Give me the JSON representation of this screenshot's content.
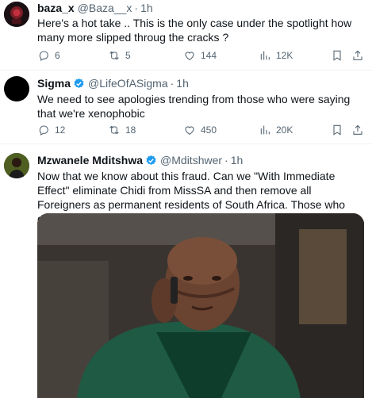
{
  "tweets": [
    {
      "name": "baza_x",
      "handle": "@Baza__x",
      "sep": "·",
      "time": "1h",
      "text": "Here's a hot take .. This is the only case under the spotlight how many more slipped throug the cracks ?",
      "replies": "6",
      "retweets": "5",
      "likes": "144",
      "views": "12K"
    },
    {
      "name": "Sigma",
      "handle": "@LifeOfASigma",
      "sep": "·",
      "time": "1h",
      "text": "We need to see apologies trending from those who were saying that we're xenophobic",
      "replies": "12",
      "retweets": "18",
      "likes": "450",
      "views": "20K"
    },
    {
      "name": "Mzwanele Mditshwa",
      "handle": "@Mditshwer",
      "sep": "·",
      "time": "1h",
      "text": "Now that we know about this fraud. Can we \"With Immediate Effect\" eliminate Chidi from MissSA and then remove all Foreigners as permanent residents of South Africa. Those who deserve it must apply again"
    }
  ],
  "icons": {
    "reply": "reply-icon",
    "retweet": "retweet-icon",
    "like": "heart-icon",
    "views": "views-icon",
    "bookmark": "bookmark-icon",
    "share": "share-icon",
    "verified": "verified-badge-icon"
  },
  "colors": {
    "text": "#0f1419",
    "secondary": "#536471",
    "verified": "#1d9bf0",
    "divider": "#eff3f4"
  }
}
